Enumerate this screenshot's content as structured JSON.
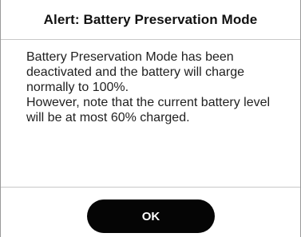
{
  "dialog": {
    "title": "Alert: Battery Preservation Mode",
    "message_line_1": "Battery Preservation Mode has been deactivated and the battery will charge normally to 100%.",
    "message_line_2": "However, note that the current battery level will be at most 60% charged.",
    "ok_label": "OK"
  }
}
